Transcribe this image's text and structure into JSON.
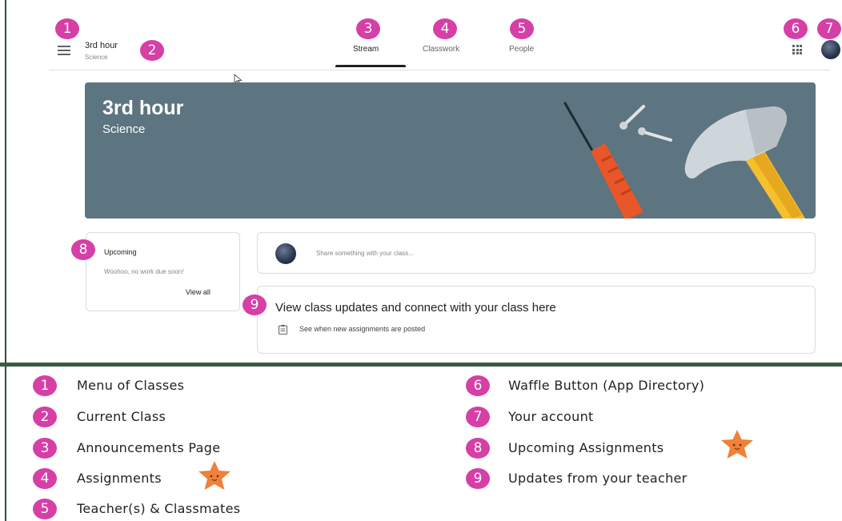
{
  "header": {
    "class_name": "3rd hour",
    "class_subject": "Science",
    "tabs": [
      {
        "label": "Stream",
        "active": true
      },
      {
        "label": "Classwork",
        "active": false
      },
      {
        "label": "People",
        "active": false
      }
    ],
    "icons": [
      "menu-icon",
      "waffle-icon",
      "avatar"
    ]
  },
  "banner": {
    "title": "3rd hour",
    "subtitle": "Science",
    "background_color": "#5c7580"
  },
  "upcoming": {
    "title": "Upcoming",
    "empty_text": "Woohoo, no work due soon!",
    "view_all": "View all"
  },
  "share": {
    "placeholder": "Share something with your class..."
  },
  "info": {
    "headline": "View class updates and connect with your class here",
    "line": "See when new assignments are posted"
  },
  "badges": [
    "1",
    "2",
    "3",
    "4",
    "5",
    "6",
    "7",
    "8",
    "9"
  ],
  "legend": [
    {
      "number": "1",
      "label": "Menu of Classes"
    },
    {
      "number": "2",
      "label": "Current Class"
    },
    {
      "number": "3",
      "label": "Announcements Page"
    },
    {
      "number": "4",
      "label": "Assignments"
    },
    {
      "number": "5",
      "label": "Teacher(s) & Classmates"
    },
    {
      "number": "6",
      "label": "Waffle Button (App Directory)"
    },
    {
      "number": "7",
      "label": "Your account"
    },
    {
      "number": "8",
      "label": "Upcoming Assignments"
    },
    {
      "number": "9",
      "label": "Updates from your teacher"
    }
  ],
  "colors": {
    "badge": "#d63fa6",
    "star": "#f0803a",
    "divider": "#3a5a45"
  }
}
